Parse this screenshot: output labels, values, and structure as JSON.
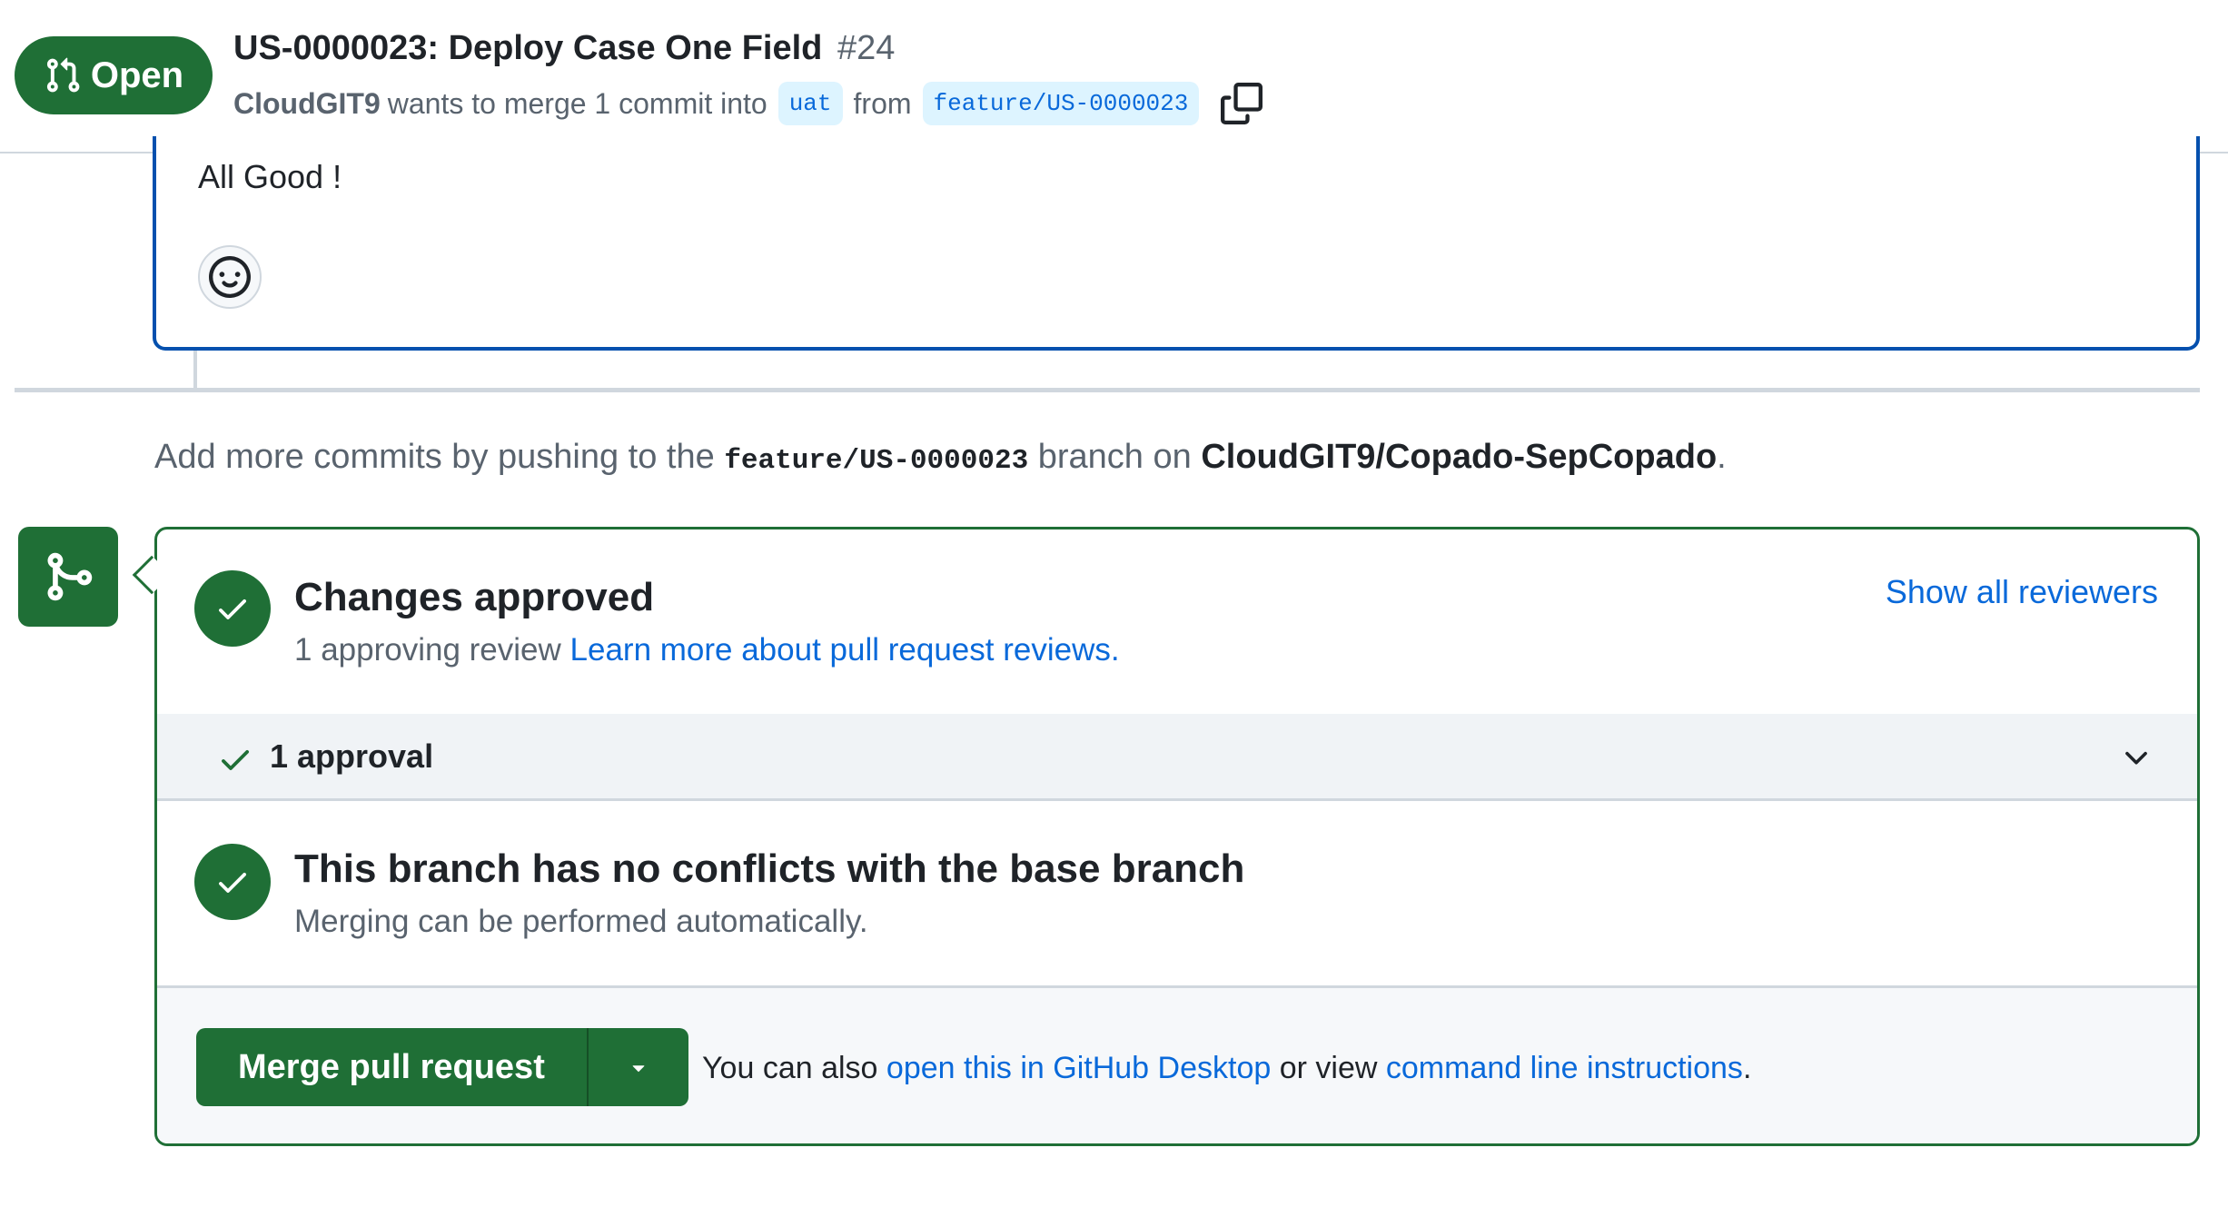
{
  "header": {
    "state_label": "Open",
    "title": "US-0000023: Deploy Case One Field",
    "number": "#24",
    "author": "CloudGIT9",
    "merge_text": "wants to merge 1 commit into",
    "base_branch": "uat",
    "from_text": "from",
    "head_branch": "feature/US-0000023"
  },
  "comment": {
    "body": "All Good !"
  },
  "push_hint": {
    "prefix": "Add more commits by pushing to the",
    "branch": "feature/US-0000023",
    "middle": "branch on",
    "repo": "CloudGIT9/Copado-SepCopado",
    "suffix": "."
  },
  "merge_box": {
    "review": {
      "title": "Changes approved",
      "count_text": "1 approving review",
      "learn_more": "Learn more about pull request reviews.",
      "show_reviewers": "Show all reviewers"
    },
    "approvals": {
      "label": "1 approval"
    },
    "conflicts": {
      "title": "This branch has no conflicts with the base branch",
      "subtitle": "Merging can be performed automatically."
    },
    "merge": {
      "button_label": "Merge pull request",
      "also_text": "You can also",
      "desktop_link": "open this in GitHub Desktop",
      "or_view": "or view",
      "cli_link": "command line instructions",
      "suffix": "."
    }
  },
  "colors": {
    "success": "#1f6f36",
    "link": "#0969da",
    "focus_border": "#0550ae",
    "muted_text": "#59636e"
  },
  "icons": {
    "state": "git-pull-request-icon",
    "copy": "copy-icon",
    "emoji": "smiley-icon",
    "merge": "git-merge-icon",
    "check": "check-icon",
    "chevron": "chevron-down-icon",
    "caret": "triangle-down-icon"
  }
}
